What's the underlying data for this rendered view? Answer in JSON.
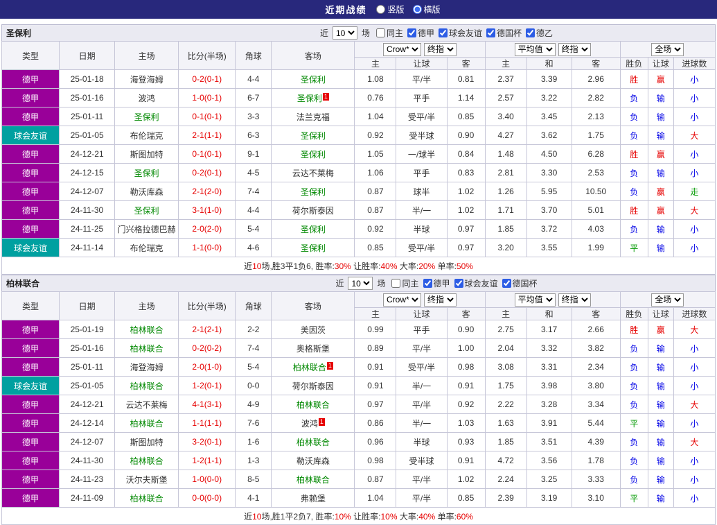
{
  "topbar": {
    "title": "近期战绩",
    "layout_options": [
      {
        "key": "vertical",
        "label": "竖版",
        "selected": false
      },
      {
        "key": "horizontal",
        "label": "横版",
        "selected": true
      }
    ]
  },
  "colors": {
    "league": {
      "德甲": "#990099",
      "球会友谊": "#00a0a0"
    },
    "text": {
      "red": "#e60000",
      "blue": "#0000e6",
      "green": "#009900",
      "black": "#333333"
    },
    "focal_team": "#008800",
    "score": "#e60000"
  },
  "table_header": {
    "static": [
      "类型",
      "日期",
      "主场",
      "比分(半场)",
      "角球",
      "客场"
    ],
    "odds_group_selects": [
      "Crow*",
      "终指"
    ],
    "avg_group_selects": [
      "平均值",
      "终指"
    ],
    "scope_select": "全场",
    "sub": [
      "主",
      "让球",
      "客",
      "主",
      "和",
      "客",
      "胜负",
      "让球",
      "进球数"
    ]
  },
  "sections": [
    {
      "key": "st-pauli",
      "team": "圣保利",
      "filter": {
        "near": "近",
        "count": "10",
        "unit": "场",
        "checkboxes": [
          {
            "key": "same-home",
            "label": "同主",
            "checked": false
          },
          {
            "key": "bundesliga",
            "label": "德甲",
            "checked": true
          },
          {
            "key": "club-friendly",
            "label": "球会友谊",
            "checked": true
          },
          {
            "key": "dfb-pokal",
            "label": "德国杯",
            "checked": true
          },
          {
            "key": "bundesliga2",
            "label": "德乙",
            "checked": true
          }
        ]
      },
      "rows": [
        {
          "league": "德甲",
          "date": "25-01-18",
          "home": {
            "name": "海登海姆"
          },
          "score": "0-2(0-1)",
          "corners": "4-4",
          "away": {
            "name": "圣保利",
            "focal": true
          },
          "odds": [
            "1.08",
            "平/半",
            "0.81",
            "2.37",
            "3.39",
            "2.96"
          ],
          "results": [
            {
              "t": "胜",
              "c": "red"
            },
            {
              "t": "赢",
              "c": "red"
            },
            {
              "t": "小",
              "c": "blue"
            }
          ]
        },
        {
          "league": "德甲",
          "date": "25-01-16",
          "home": {
            "name": "波鸿"
          },
          "score": "1-0(0-1)",
          "corners": "6-7",
          "away": {
            "name": "圣保利",
            "focal": true,
            "redcard": true
          },
          "odds": [
            "0.76",
            "平手",
            "1.14",
            "2.57",
            "3.22",
            "2.82"
          ],
          "results": [
            {
              "t": "负",
              "c": "blue"
            },
            {
              "t": "输",
              "c": "blue"
            },
            {
              "t": "小",
              "c": "blue"
            }
          ]
        },
        {
          "league": "德甲",
          "date": "25-01-11",
          "home": {
            "name": "圣保利",
            "focal": true
          },
          "score": "0-1(0-1)",
          "corners": "3-3",
          "away": {
            "name": "法兰克福"
          },
          "odds": [
            "1.04",
            "受平/半",
            "0.85",
            "3.40",
            "3.45",
            "2.13"
          ],
          "results": [
            {
              "t": "负",
              "c": "blue"
            },
            {
              "t": "输",
              "c": "blue"
            },
            {
              "t": "小",
              "c": "blue"
            }
          ]
        },
        {
          "league": "球会友谊",
          "date": "25-01-05",
          "home": {
            "name": "布伦瑞克"
          },
          "score": "2-1(1-1)",
          "corners": "6-3",
          "away": {
            "name": "圣保利",
            "focal": true
          },
          "odds": [
            "0.92",
            "受半球",
            "0.90",
            "4.27",
            "3.62",
            "1.75"
          ],
          "results": [
            {
              "t": "负",
              "c": "blue"
            },
            {
              "t": "输",
              "c": "blue"
            },
            {
              "t": "大",
              "c": "red"
            }
          ]
        },
        {
          "league": "德甲",
          "date": "24-12-21",
          "home": {
            "name": "斯图加特"
          },
          "score": "0-1(0-1)",
          "corners": "9-1",
          "away": {
            "name": "圣保利",
            "focal": true
          },
          "odds": [
            "1.05",
            "一/球半",
            "0.84",
            "1.48",
            "4.50",
            "6.28"
          ],
          "results": [
            {
              "t": "胜",
              "c": "red"
            },
            {
              "t": "赢",
              "c": "red"
            },
            {
              "t": "小",
              "c": "blue"
            }
          ]
        },
        {
          "league": "德甲",
          "date": "24-12-15",
          "home": {
            "name": "圣保利",
            "focal": true
          },
          "score": "0-2(0-1)",
          "corners": "4-5",
          "away": {
            "name": "云达不莱梅"
          },
          "odds": [
            "1.06",
            "平手",
            "0.83",
            "2.81",
            "3.30",
            "2.53"
          ],
          "results": [
            {
              "t": "负",
              "c": "blue"
            },
            {
              "t": "输",
              "c": "blue"
            },
            {
              "t": "小",
              "c": "blue"
            }
          ]
        },
        {
          "league": "德甲",
          "date": "24-12-07",
          "home": {
            "name": "勒沃库森"
          },
          "score": "2-1(2-0)",
          "corners": "7-4",
          "away": {
            "name": "圣保利",
            "focal": true
          },
          "odds": [
            "0.87",
            "球半",
            "1.02",
            "1.26",
            "5.95",
            "10.50"
          ],
          "results": [
            {
              "t": "负",
              "c": "blue"
            },
            {
              "t": "赢",
              "c": "red"
            },
            {
              "t": "走",
              "c": "green"
            }
          ]
        },
        {
          "league": "德甲",
          "date": "24-11-30",
          "home": {
            "name": "圣保利",
            "focal": true
          },
          "score": "3-1(1-0)",
          "corners": "4-4",
          "away": {
            "name": "荷尔斯泰因"
          },
          "odds": [
            "0.87",
            "半/一",
            "1.02",
            "1.71",
            "3.70",
            "5.01"
          ],
          "results": [
            {
              "t": "胜",
              "c": "red"
            },
            {
              "t": "赢",
              "c": "red"
            },
            {
              "t": "大",
              "c": "red"
            }
          ]
        },
        {
          "league": "德甲",
          "date": "24-11-25",
          "home": {
            "name": "门兴格拉德巴赫"
          },
          "score": "2-0(2-0)",
          "corners": "5-4",
          "away": {
            "name": "圣保利",
            "focal": true
          },
          "odds": [
            "0.92",
            "半球",
            "0.97",
            "1.85",
            "3.72",
            "4.03"
          ],
          "results": [
            {
              "t": "负",
              "c": "blue"
            },
            {
              "t": "输",
              "c": "blue"
            },
            {
              "t": "小",
              "c": "blue"
            }
          ]
        },
        {
          "league": "球会友谊",
          "date": "24-11-14",
          "home": {
            "name": "布伦瑞克"
          },
          "score": "1-1(0-0)",
          "corners": "4-6",
          "away": {
            "name": "圣保利",
            "focal": true
          },
          "odds": [
            "0.85",
            "受平/半",
            "0.97",
            "3.20",
            "3.55",
            "1.99"
          ],
          "results": [
            {
              "t": "平",
              "c": "green"
            },
            {
              "t": "输",
              "c": "blue"
            },
            {
              "t": "小",
              "c": "blue"
            }
          ]
        }
      ],
      "summary": [
        {
          "t": "近"
        },
        {
          "t": "10",
          "c": "red"
        },
        {
          "t": "场,胜3平1负6, 胜率:"
        },
        {
          "t": "30%",
          "c": "red"
        },
        {
          "t": " 让胜率:"
        },
        {
          "t": "40%",
          "c": "red"
        },
        {
          "t": " 大率:"
        },
        {
          "t": "20%",
          "c": "red"
        },
        {
          "t": " 单率:"
        },
        {
          "t": "50%",
          "c": "red"
        }
      ]
    },
    {
      "key": "union-berlin",
      "team": "柏林联合",
      "filter": {
        "near": "近",
        "count": "10",
        "unit": "场",
        "checkboxes": [
          {
            "key": "same-home",
            "label": "同主",
            "checked": false
          },
          {
            "key": "bundesliga",
            "label": "德甲",
            "checked": true
          },
          {
            "key": "club-friendly",
            "label": "球会友谊",
            "checked": true
          },
          {
            "key": "dfb-pokal",
            "label": "德国杯",
            "checked": true
          }
        ]
      },
      "rows": [
        {
          "league": "德甲",
          "date": "25-01-19",
          "home": {
            "name": "柏林联合",
            "focal": true
          },
          "score": "2-1(2-1)",
          "corners": "2-2",
          "away": {
            "name": "美因茨"
          },
          "odds": [
            "0.99",
            "平手",
            "0.90",
            "2.75",
            "3.17",
            "2.66"
          ],
          "results": [
            {
              "t": "胜",
              "c": "red"
            },
            {
              "t": "赢",
              "c": "red"
            },
            {
              "t": "大",
              "c": "red"
            }
          ]
        },
        {
          "league": "德甲",
          "date": "25-01-16",
          "home": {
            "name": "柏林联合",
            "focal": true
          },
          "score": "0-2(0-2)",
          "corners": "7-4",
          "away": {
            "name": "奥格斯堡"
          },
          "odds": [
            "0.89",
            "平/半",
            "1.00",
            "2.04",
            "3.32",
            "3.82"
          ],
          "results": [
            {
              "t": "负",
              "c": "blue"
            },
            {
              "t": "输",
              "c": "blue"
            },
            {
              "t": "小",
              "c": "blue"
            }
          ]
        },
        {
          "league": "德甲",
          "date": "25-01-11",
          "home": {
            "name": "海登海姆"
          },
          "score": "2-0(1-0)",
          "corners": "5-4",
          "away": {
            "name": "柏林联合",
            "focal": true,
            "redcard": true
          },
          "odds": [
            "0.91",
            "受平/半",
            "0.98",
            "3.08",
            "3.31",
            "2.34"
          ],
          "results": [
            {
              "t": "负",
              "c": "blue"
            },
            {
              "t": "输",
              "c": "blue"
            },
            {
              "t": "小",
              "c": "blue"
            }
          ]
        },
        {
          "league": "球会友谊",
          "date": "25-01-05",
          "home": {
            "name": "柏林联合",
            "focal": true
          },
          "score": "1-2(0-1)",
          "corners": "0-0",
          "away": {
            "name": "荷尔斯泰因"
          },
          "odds": [
            "0.91",
            "半/一",
            "0.91",
            "1.75",
            "3.98",
            "3.80"
          ],
          "results": [
            {
              "t": "负",
              "c": "blue"
            },
            {
              "t": "输",
              "c": "blue"
            },
            {
              "t": "小",
              "c": "blue"
            }
          ]
        },
        {
          "league": "德甲",
          "date": "24-12-21",
          "home": {
            "name": "云达不莱梅"
          },
          "score": "4-1(3-1)",
          "corners": "4-9",
          "away": {
            "name": "柏林联合",
            "focal": true
          },
          "odds": [
            "0.97",
            "平/半",
            "0.92",
            "2.22",
            "3.28",
            "3.34"
          ],
          "results": [
            {
              "t": "负",
              "c": "blue"
            },
            {
              "t": "输",
              "c": "blue"
            },
            {
              "t": "大",
              "c": "red"
            }
          ]
        },
        {
          "league": "德甲",
          "date": "24-12-14",
          "home": {
            "name": "柏林联合",
            "focal": true
          },
          "score": "1-1(1-1)",
          "corners": "7-6",
          "away": {
            "name": "波鸿",
            "redcard": true
          },
          "odds": [
            "0.86",
            "半/一",
            "1.03",
            "1.63",
            "3.91",
            "5.44"
          ],
          "results": [
            {
              "t": "平",
              "c": "green"
            },
            {
              "t": "输",
              "c": "blue"
            },
            {
              "t": "小",
              "c": "blue"
            }
          ]
        },
        {
          "league": "德甲",
          "date": "24-12-07",
          "home": {
            "name": "斯图加特"
          },
          "score": "3-2(0-1)",
          "corners": "1-6",
          "away": {
            "name": "柏林联合",
            "focal": true
          },
          "odds": [
            "0.96",
            "半球",
            "0.93",
            "1.85",
            "3.51",
            "4.39"
          ],
          "results": [
            {
              "t": "负",
              "c": "blue"
            },
            {
              "t": "输",
              "c": "blue"
            },
            {
              "t": "大",
              "c": "red"
            }
          ]
        },
        {
          "league": "德甲",
          "date": "24-11-30",
          "home": {
            "name": "柏林联合",
            "focal": true
          },
          "score": "1-2(1-1)",
          "corners": "1-3",
          "away": {
            "name": "勒沃库森"
          },
          "odds": [
            "0.98",
            "受半球",
            "0.91",
            "4.72",
            "3.56",
            "1.78"
          ],
          "results": [
            {
              "t": "负",
              "c": "blue"
            },
            {
              "t": "输",
              "c": "blue"
            },
            {
              "t": "小",
              "c": "blue"
            }
          ]
        },
        {
          "league": "德甲",
          "date": "24-11-23",
          "home": {
            "name": "沃尔夫斯堡"
          },
          "score": "1-0(0-0)",
          "corners": "8-5",
          "away": {
            "name": "柏林联合",
            "focal": true
          },
          "odds": [
            "0.87",
            "平/半",
            "1.02",
            "2.24",
            "3.25",
            "3.33"
          ],
          "results": [
            {
              "t": "负",
              "c": "blue"
            },
            {
              "t": "输",
              "c": "blue"
            },
            {
              "t": "小",
              "c": "blue"
            }
          ]
        },
        {
          "league": "德甲",
          "date": "24-11-09",
          "home": {
            "name": "柏林联合",
            "focal": true
          },
          "score": "0-0(0-0)",
          "corners": "4-1",
          "away": {
            "name": "弗赖堡"
          },
          "odds": [
            "1.04",
            "平/半",
            "0.85",
            "2.39",
            "3.19",
            "3.10"
          ],
          "results": [
            {
              "t": "平",
              "c": "green"
            },
            {
              "t": "输",
              "c": "blue"
            },
            {
              "t": "小",
              "c": "blue"
            }
          ]
        }
      ],
      "summary": [
        {
          "t": "近"
        },
        {
          "t": "10",
          "c": "red"
        },
        {
          "t": "场,胜1平2负7, 胜率:"
        },
        {
          "t": "10%",
          "c": "red"
        },
        {
          "t": " 让胜率:"
        },
        {
          "t": "10%",
          "c": "red"
        },
        {
          "t": " 大率:"
        },
        {
          "t": "40%",
          "c": "red"
        },
        {
          "t": " 单率:"
        },
        {
          "t": "60%",
          "c": "red"
        }
      ]
    }
  ]
}
